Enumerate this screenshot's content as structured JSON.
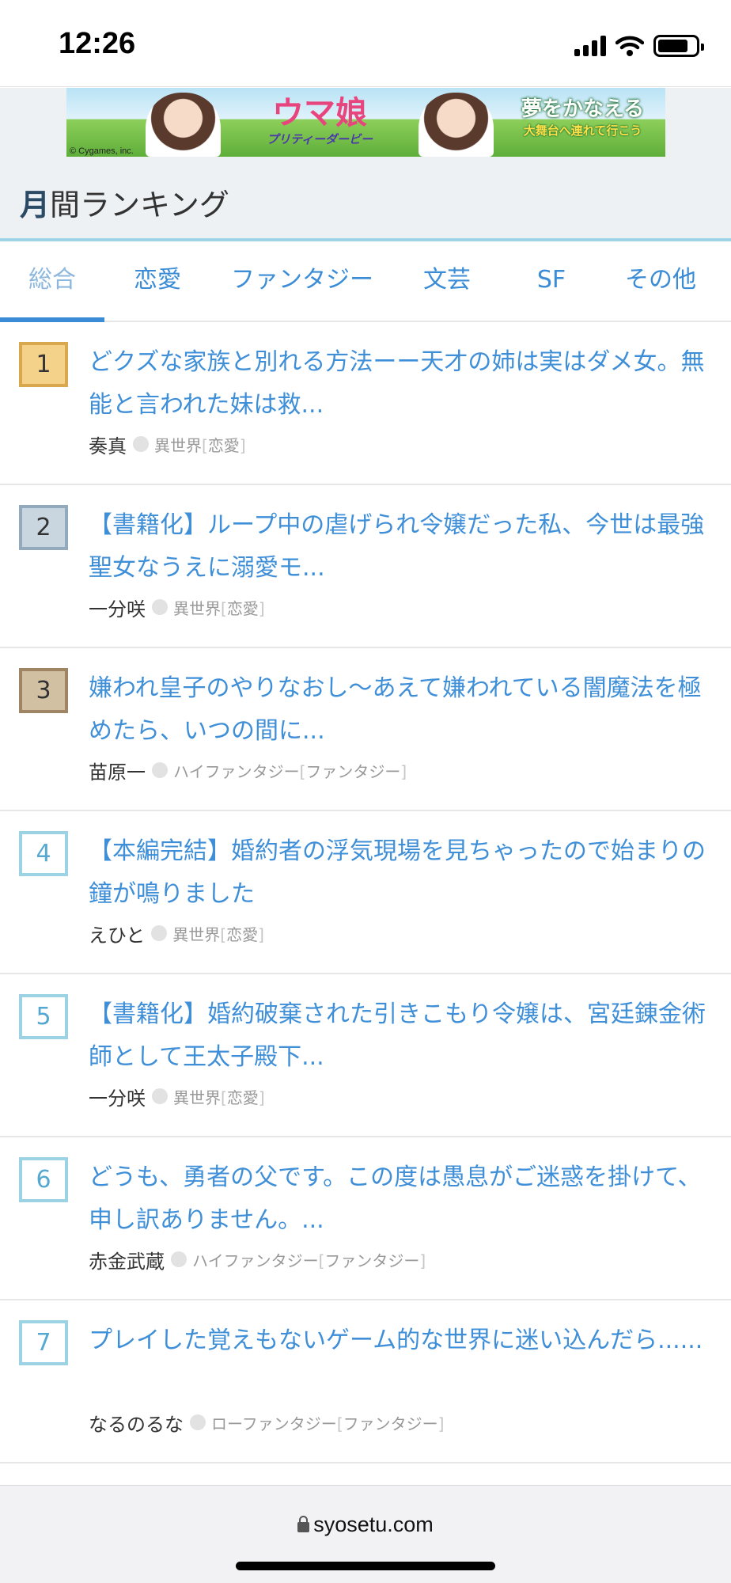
{
  "status_bar": {
    "time": "12:26",
    "battery_level": 0.8
  },
  "banner": {
    "logo": "ウマ娘",
    "logo_sub": "プリティーダービー",
    "slogan_main": "夢をかなえる",
    "slogan_sub": "大舞台へ連れて行こう",
    "copyright": "© Cygames, inc."
  },
  "section": {
    "title_first": "月",
    "title_rest": "間ランキング"
  },
  "tabs": [
    "総合",
    "恋愛",
    "ファンタジー",
    "文芸",
    "SF",
    "その他"
  ],
  "active_tab": "総合",
  "ranking": [
    {
      "rank": "1",
      "title": "どクズな家族と別れる方法ーー天才の姉は実はダメ女。無能と言われた妹は救...",
      "author": "奏真",
      "genre": "異世界",
      "category": "恋愛"
    },
    {
      "rank": "2",
      "title": "【書籍化】ループ中の虐げられ令嬢だった私、今世は最強聖女なうえに溺愛モ...",
      "author": "一分咲",
      "genre": "異世界",
      "category": "恋愛"
    },
    {
      "rank": "3",
      "title": "嫌われ皇子のやりなおし～あえて嫌われている闇魔法を極めたら、いつの間に...",
      "author": "苗原一",
      "genre": "ハイファンタジー",
      "category": "ファンタジー"
    },
    {
      "rank": "4",
      "title": "【本編完結】婚約者の浮気現場を見ちゃったので始まりの鐘が鳴りました",
      "author": "えひと",
      "genre": "異世界",
      "category": "恋愛"
    },
    {
      "rank": "5",
      "title": "【書籍化】婚約破棄された引きこもり令嬢は、宮廷錬金術師として王太子殿下...",
      "author": "一分咲",
      "genre": "異世界",
      "category": "恋愛"
    },
    {
      "rank": "6",
      "title": "どうも、勇者の父です。この度は愚息がご迷惑を掛けて、申し訳ありません。...",
      "author": "赤金武蔵",
      "genre": "ハイファンタジー",
      "category": "ファンタジー"
    },
    {
      "rank": "7",
      "title": "プレイした覚えもないゲーム的な世界に迷い込んだら......",
      "author": "なるのるな",
      "genre": "ローファンタジー",
      "category": "ファンタジー"
    }
  ],
  "browser": {
    "url": "syosetu.com"
  },
  "colors": {
    "link": "#3f8fd8",
    "tab_accent": "#3b8cd6",
    "gold": "#f4d28a",
    "silver": "#c9d6e0",
    "bronze": "#d2c0a2",
    "rank_border": "#9bd3e5"
  }
}
